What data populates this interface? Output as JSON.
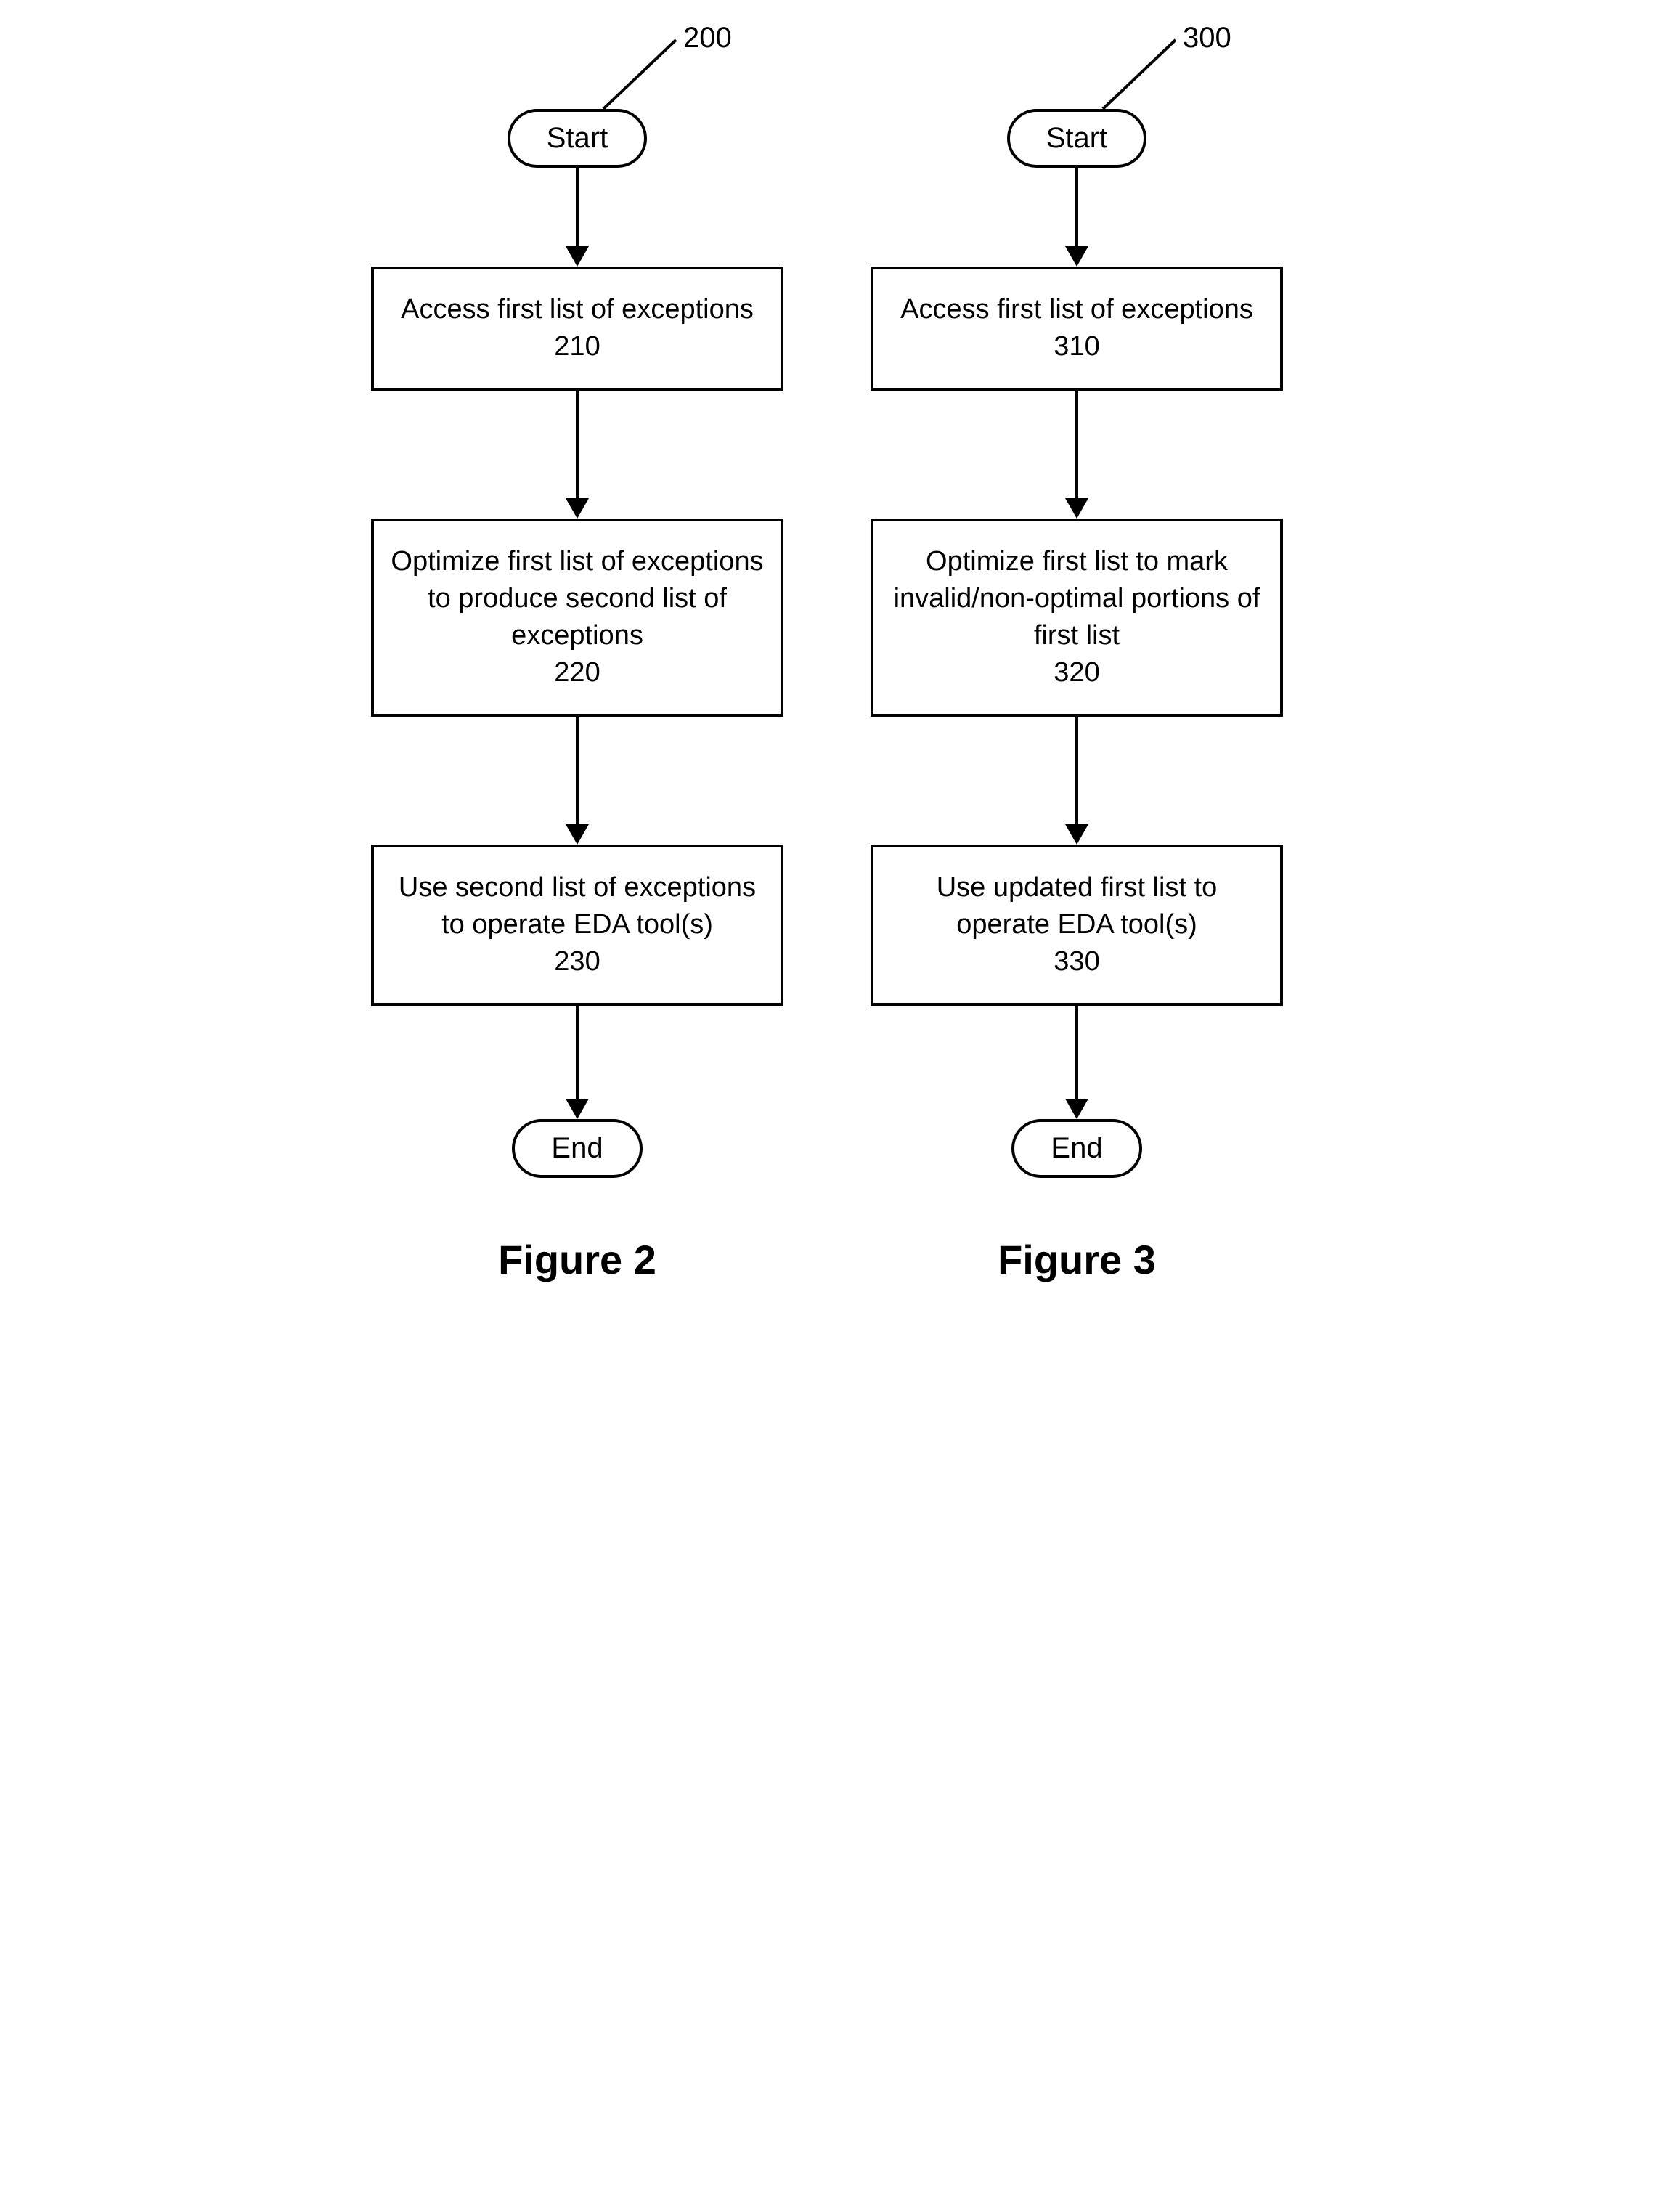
{
  "flowcharts": [
    {
      "ref": "200",
      "start": "Start",
      "boxes": [
        {
          "text": "Access first list of exceptions",
          "num": "210"
        },
        {
          "text": "Optimize first list of exceptions to produce second list of exceptions",
          "num": "220"
        },
        {
          "text": "Use second list of exceptions to operate EDA tool(s)",
          "num": "230"
        }
      ],
      "end": "End",
      "title": "Figure 2"
    },
    {
      "ref": "300",
      "start": "Start",
      "boxes": [
        {
          "text": "Access first list of exceptions",
          "num": "310"
        },
        {
          "text": "Optimize first list to mark invalid/non-optimal portions of first list",
          "num": "320"
        },
        {
          "text": "Use updated first list to operate EDA tool(s)",
          "num": "330"
        }
      ],
      "end": "End",
      "title": "Figure 3"
    }
  ]
}
